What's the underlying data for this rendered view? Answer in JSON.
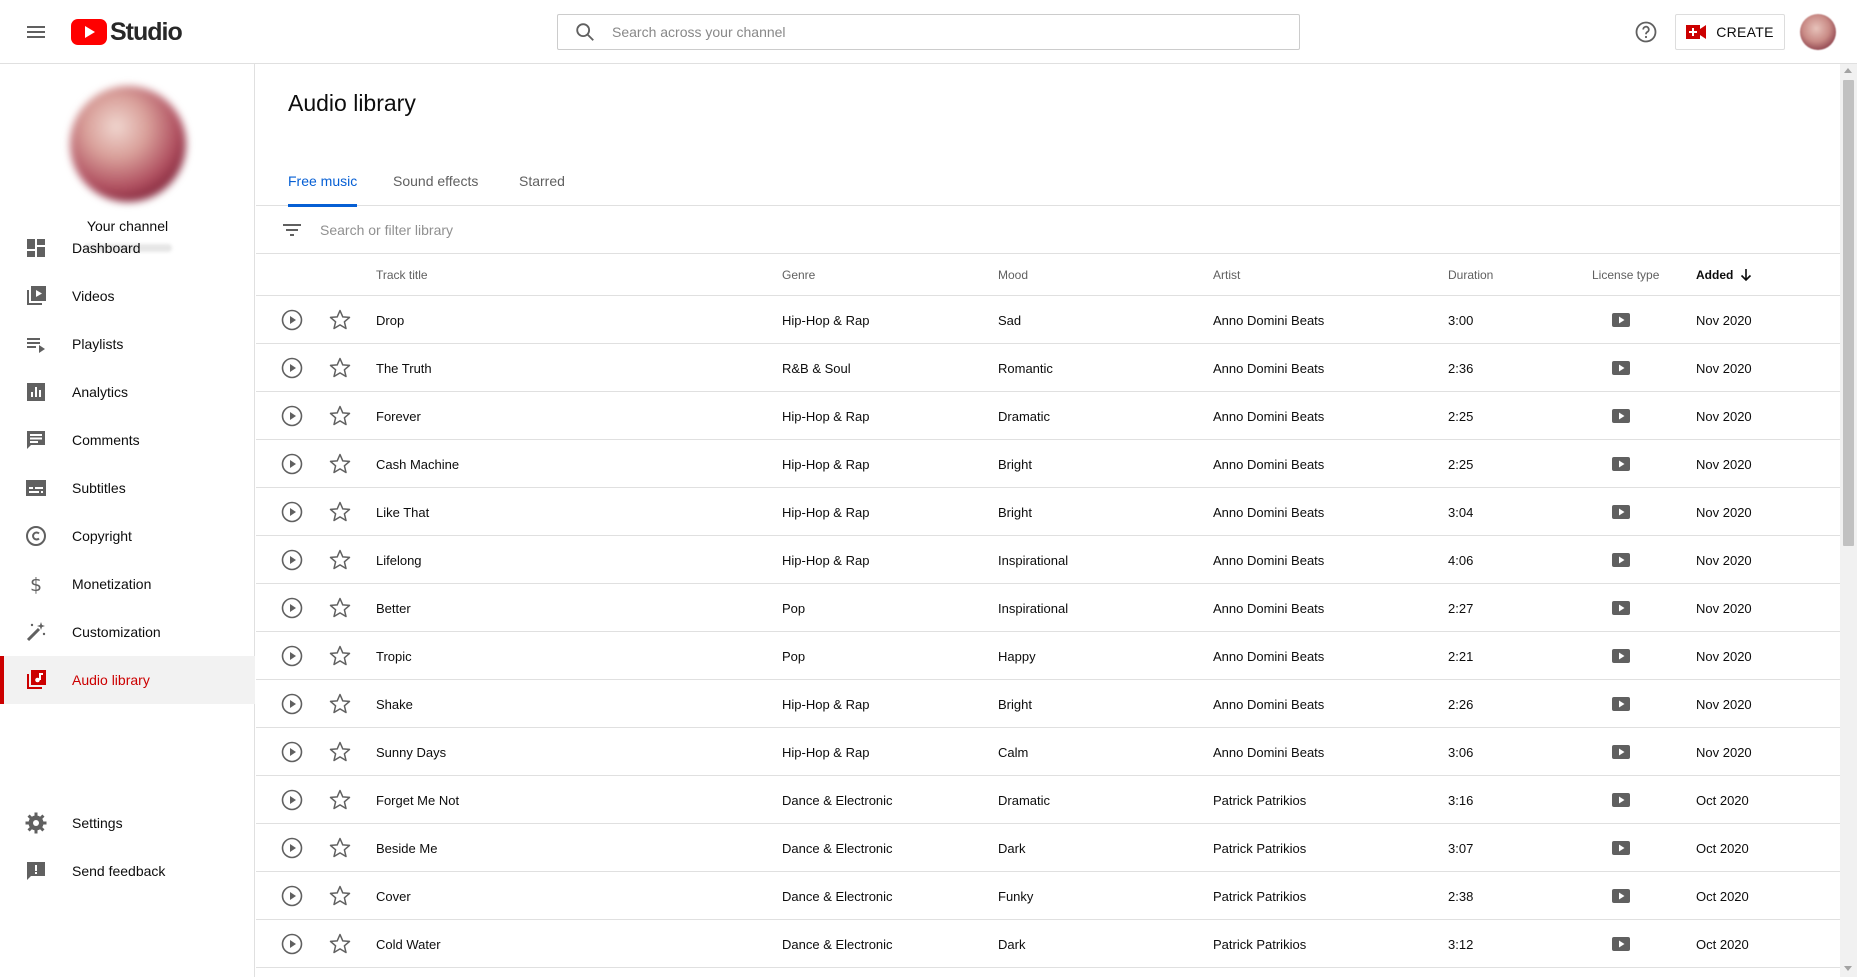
{
  "header": {
    "logo_text": "Studio",
    "search_placeholder": "Search across your channel",
    "create_label": "CREATE",
    "brand_color": "#ff0000"
  },
  "sidebar": {
    "channel_label": "Your channel",
    "items": [
      {
        "label": "Dashboard",
        "icon": "dashboard-icon"
      },
      {
        "label": "Videos",
        "icon": "videos-icon"
      },
      {
        "label": "Playlists",
        "icon": "playlists-icon"
      },
      {
        "label": "Analytics",
        "icon": "analytics-icon"
      },
      {
        "label": "Comments",
        "icon": "comments-icon"
      },
      {
        "label": "Subtitles",
        "icon": "subtitles-icon"
      },
      {
        "label": "Copyright",
        "icon": "copyright-icon"
      },
      {
        "label": "Monetization",
        "icon": "dollar-icon"
      },
      {
        "label": "Customization",
        "icon": "magic-wand-icon"
      },
      {
        "label": "Audio library",
        "icon": "audio-library-icon",
        "active": true
      }
    ],
    "bottom_items": [
      {
        "label": "Settings",
        "icon": "gear-icon"
      },
      {
        "label": "Send feedback",
        "icon": "feedback-icon"
      }
    ],
    "active_color": "#cc0000"
  },
  "main": {
    "title": "Audio library",
    "tabs": [
      {
        "label": "Free music",
        "active": true
      },
      {
        "label": "Sound effects"
      },
      {
        "label": "Starred"
      }
    ],
    "filter_placeholder": "Search or filter library",
    "columns": {
      "track_title": "Track title",
      "genre": "Genre",
      "mood": "Mood",
      "artist": "Artist",
      "duration": "Duration",
      "license_type": "License type",
      "added": "Added"
    },
    "sort": {
      "column": "Added",
      "direction": "descending"
    },
    "accent_color": "#065fd4",
    "tracks": [
      {
        "title": "Drop",
        "genre": "Hip-Hop & Rap",
        "mood": "Sad",
        "artist": "Anno Domini Beats",
        "duration": "3:00",
        "added": "Nov 2020"
      },
      {
        "title": "The Truth",
        "genre": "R&B & Soul",
        "mood": "Romantic",
        "artist": "Anno Domini Beats",
        "duration": "2:36",
        "added": "Nov 2020"
      },
      {
        "title": "Forever",
        "genre": "Hip-Hop & Rap",
        "mood": "Dramatic",
        "artist": "Anno Domini Beats",
        "duration": "2:25",
        "added": "Nov 2020"
      },
      {
        "title": "Cash Machine",
        "genre": "Hip-Hop & Rap",
        "mood": "Bright",
        "artist": "Anno Domini Beats",
        "duration": "2:25",
        "added": "Nov 2020"
      },
      {
        "title": "Like That",
        "genre": "Hip-Hop & Rap",
        "mood": "Bright",
        "artist": "Anno Domini Beats",
        "duration": "3:04",
        "added": "Nov 2020"
      },
      {
        "title": "Lifelong",
        "genre": "Hip-Hop & Rap",
        "mood": "Inspirational",
        "artist": "Anno Domini Beats",
        "duration": "4:06",
        "added": "Nov 2020"
      },
      {
        "title": "Better",
        "genre": "Pop",
        "mood": "Inspirational",
        "artist": "Anno Domini Beats",
        "duration": "2:27",
        "added": "Nov 2020"
      },
      {
        "title": "Tropic",
        "genre": "Pop",
        "mood": "Happy",
        "artist": "Anno Domini Beats",
        "duration": "2:21",
        "added": "Nov 2020"
      },
      {
        "title": "Shake",
        "genre": "Hip-Hop & Rap",
        "mood": "Bright",
        "artist": "Anno Domini Beats",
        "duration": "2:26",
        "added": "Nov 2020"
      },
      {
        "title": "Sunny Days",
        "genre": "Hip-Hop & Rap",
        "mood": "Calm",
        "artist": "Anno Domini Beats",
        "duration": "3:06",
        "added": "Nov 2020"
      },
      {
        "title": "Forget Me Not",
        "genre": "Dance & Electronic",
        "mood": "Dramatic",
        "artist": "Patrick Patrikios",
        "duration": "3:16",
        "added": "Oct 2020"
      },
      {
        "title": "Beside Me",
        "genre": "Dance & Electronic",
        "mood": "Dark",
        "artist": "Patrick Patrikios",
        "duration": "3:07",
        "added": "Oct 2020"
      },
      {
        "title": "Cover",
        "genre": "Dance & Electronic",
        "mood": "Funky",
        "artist": "Patrick Patrikios",
        "duration": "2:38",
        "added": "Oct 2020"
      },
      {
        "title": "Cold Water",
        "genre": "Dance & Electronic",
        "mood": "Dark",
        "artist": "Patrick Patrikios",
        "duration": "3:12",
        "added": "Oct 2020"
      }
    ]
  }
}
